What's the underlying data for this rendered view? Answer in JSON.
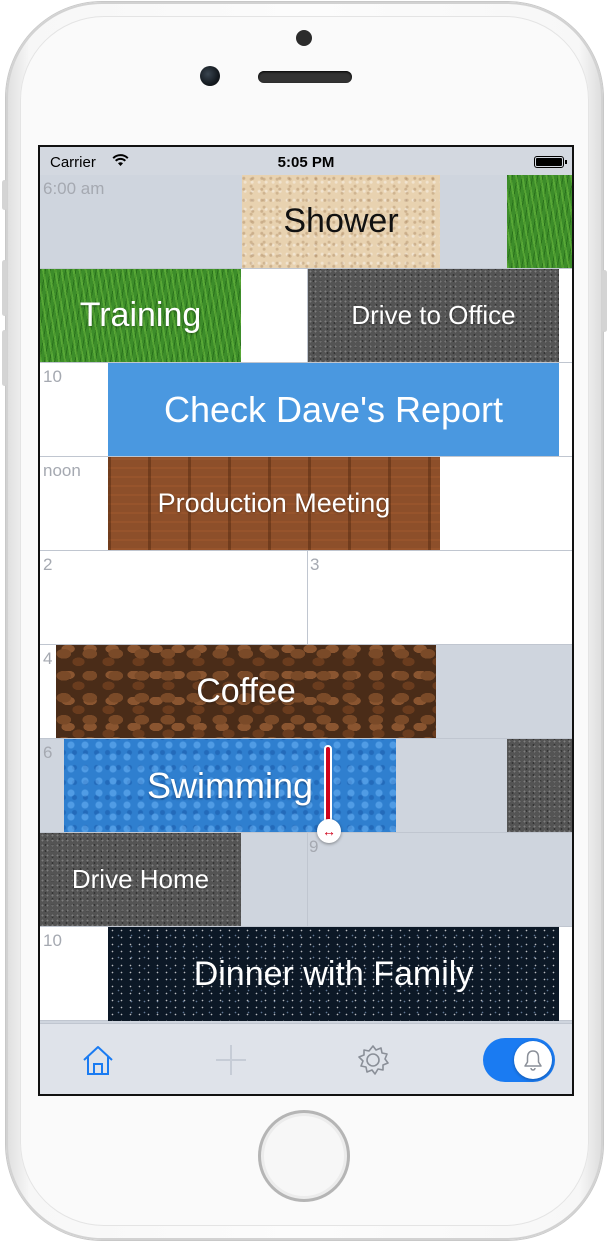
{
  "status_bar": {
    "carrier": "Carrier",
    "time": "5:05 PM"
  },
  "hours": [
    "6:00 am",
    "10",
    "noon",
    "2",
    "3",
    "4",
    "6",
    "9",
    "10"
  ],
  "events": {
    "shower": "Shower",
    "training": "Training",
    "drive_to_office": "Drive to Office",
    "check_report": "Check Dave's Report",
    "production_meeting": "Production Meeting",
    "coffee": "Coffee",
    "swimming": "Swimming",
    "drive_home": "Drive Home",
    "dinner": "Dinner with Family"
  },
  "icons": {
    "home": "home-icon",
    "add": "plus-icon",
    "settings": "gear-icon",
    "alarm": "bell-icon",
    "resize": "resize-arrows-icon",
    "wifi": "wifi-icon",
    "battery": "battery-icon"
  },
  "tab_bar": {
    "alarm_toggle_on": true
  },
  "colors": {
    "accent": "#1a7bf2",
    "event_blue": "#4a98e0",
    "handle_red": "#d0021b",
    "grid_bg": "#cfd5de"
  }
}
